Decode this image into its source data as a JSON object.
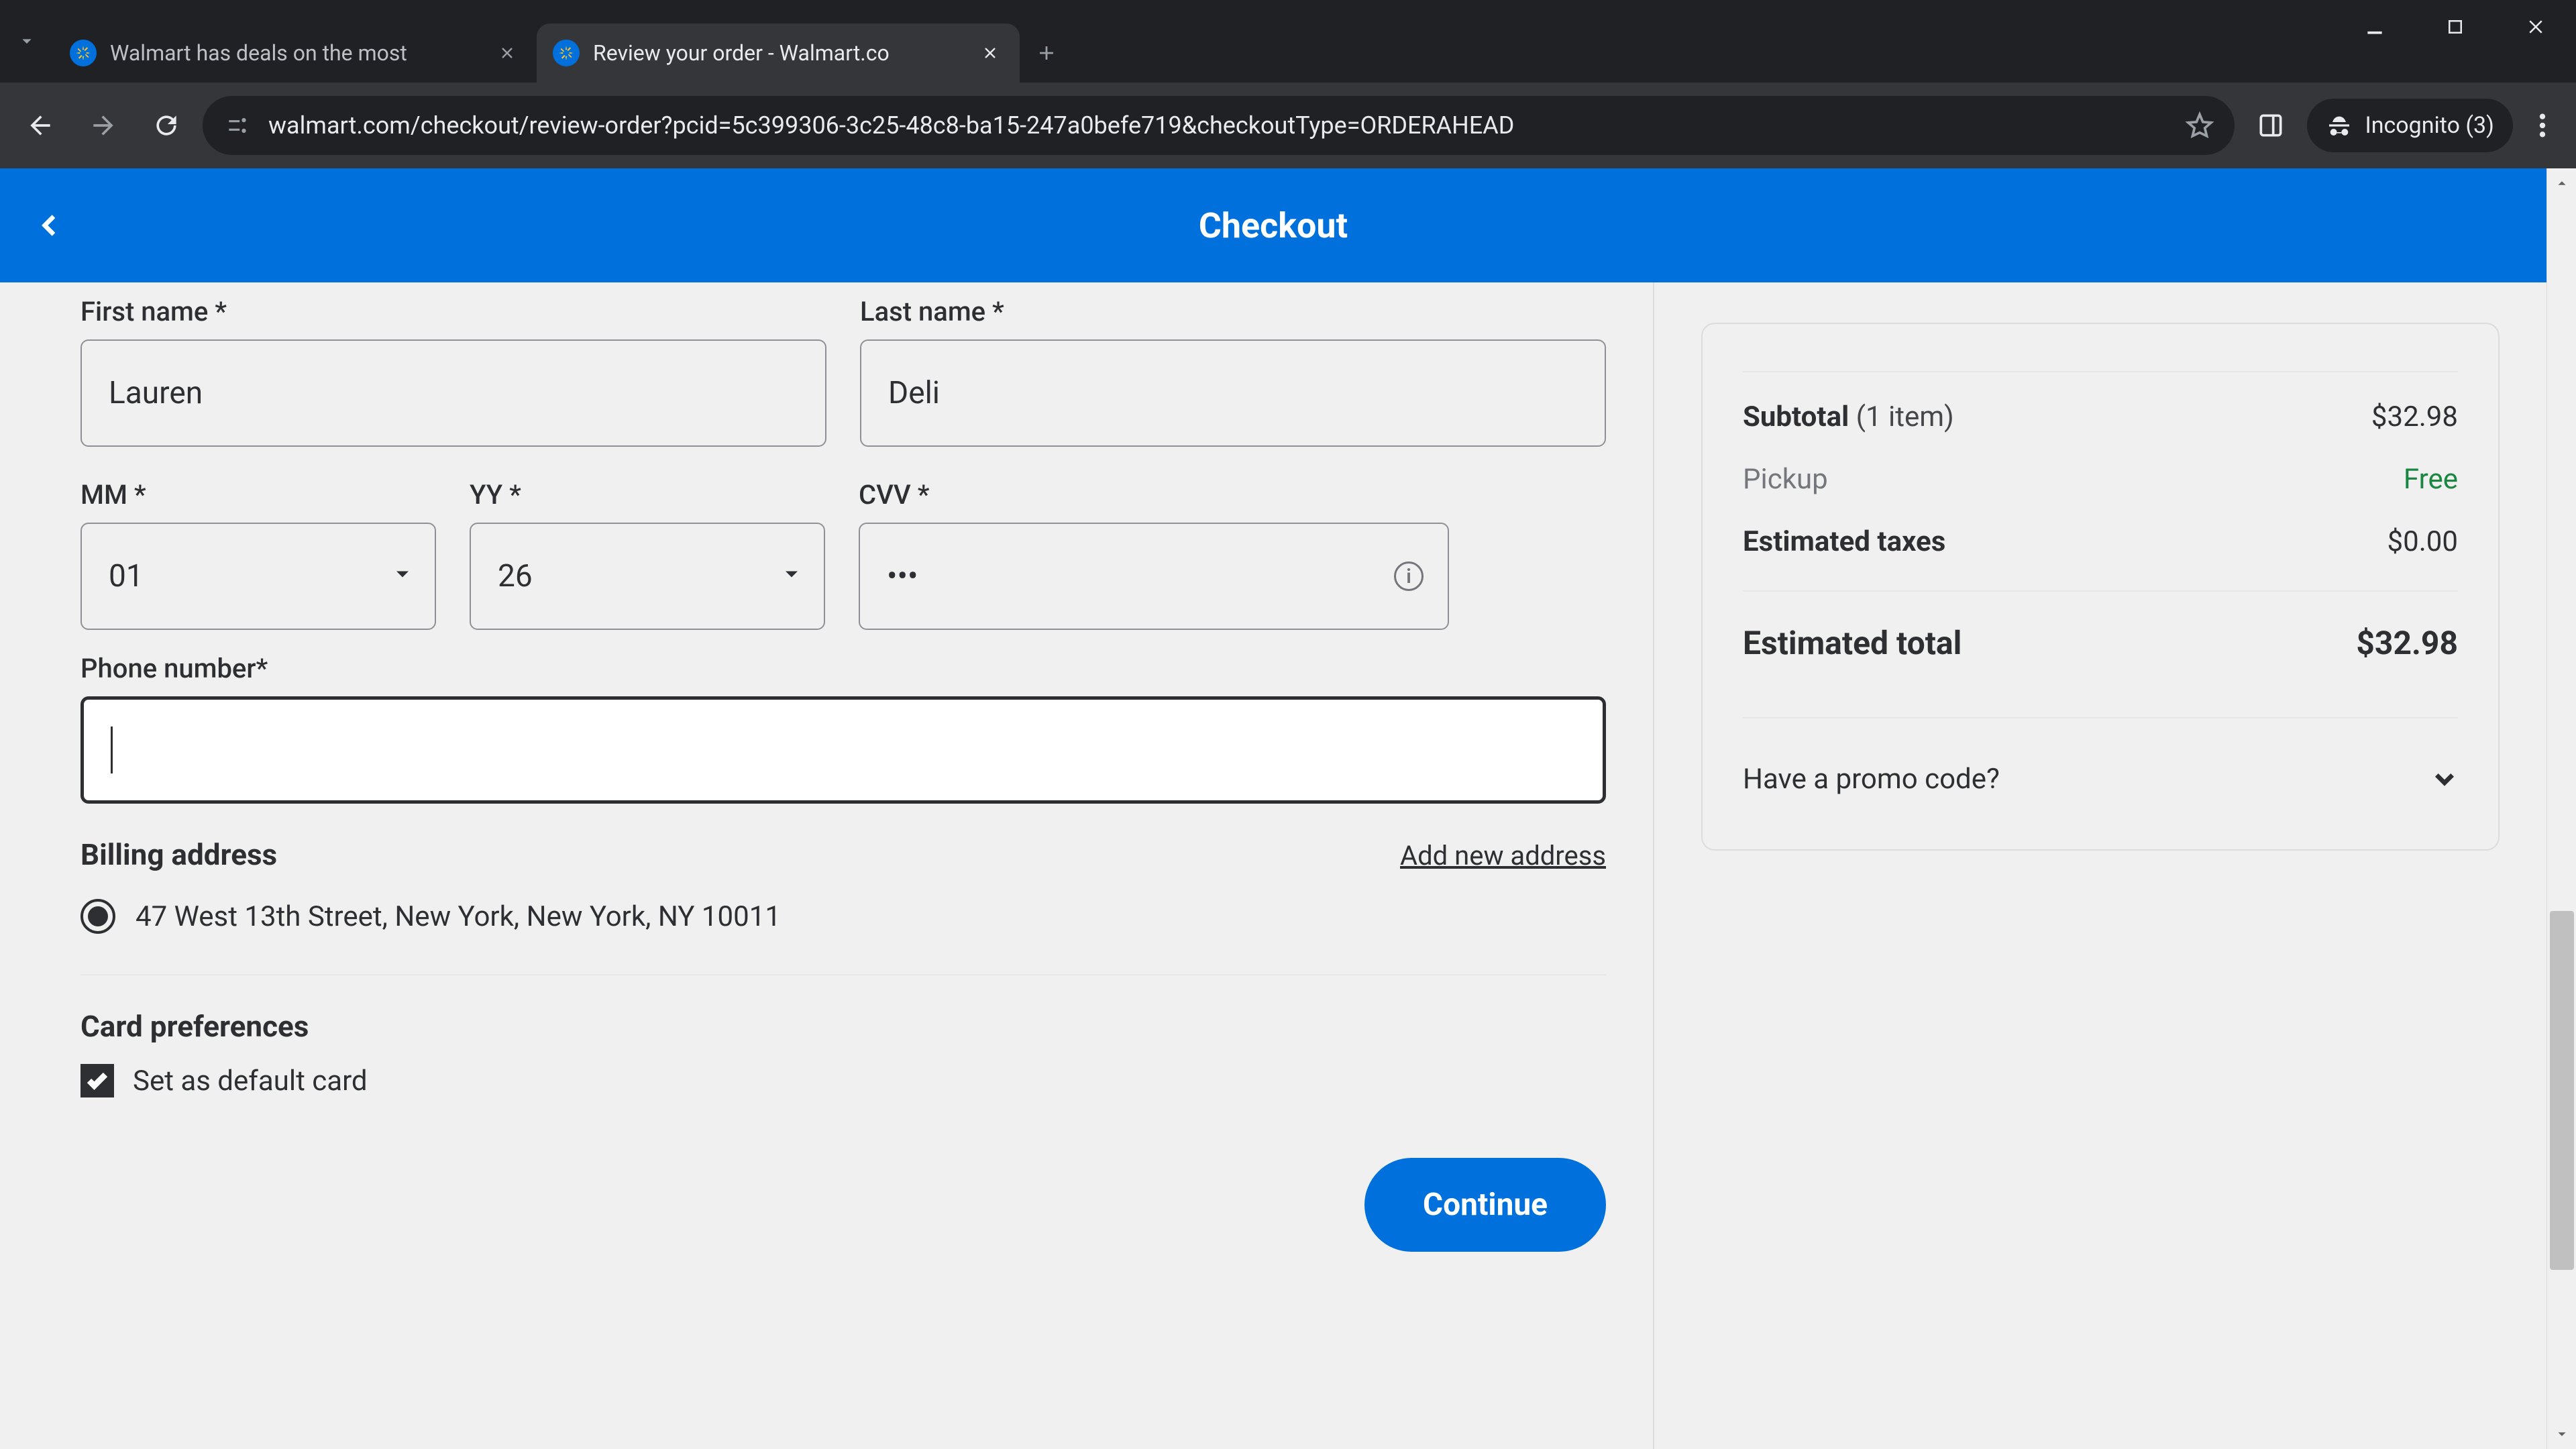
{
  "browser": {
    "tabs": [
      {
        "title": "Walmart has deals on the most",
        "active": false
      },
      {
        "title": "Review your order - Walmart.co",
        "active": true
      }
    ],
    "url": "walmart.com/checkout/review-order?pcid=5c399306-3c25-48c8-ba15-247a0befe719&checkoutType=ORDERAHEAD",
    "incognito_label": "Incognito (3)"
  },
  "header": {
    "title": "Checkout"
  },
  "form": {
    "first_name_label": "First name *",
    "first_name_value": "Lauren",
    "last_name_label": "Last name *",
    "last_name_value": "Deli",
    "mm_label": "MM *",
    "mm_value": "01",
    "yy_label": "YY *",
    "yy_value": "26",
    "cvv_label": "CVV *",
    "cvv_value": "•••",
    "phone_label": "Phone number*",
    "phone_value": "",
    "billing_title": "Billing address",
    "add_address_link": "Add new address",
    "address_option": "47 West 13th Street, New York, New York, NY 10011",
    "card_pref_title": "Card preferences",
    "default_card_label": "Set as default card",
    "default_card_checked": true,
    "continue_label": "Continue"
  },
  "summary": {
    "subtotal_label": "Subtotal",
    "subtotal_qty": "(1 item)",
    "subtotal_value": "$32.98",
    "pickup_label": "Pickup",
    "pickup_value": "Free",
    "taxes_label": "Estimated taxes",
    "taxes_value": "$0.00",
    "total_label": "Estimated total",
    "total_value": "$32.98",
    "promo_label": "Have a promo code?"
  }
}
